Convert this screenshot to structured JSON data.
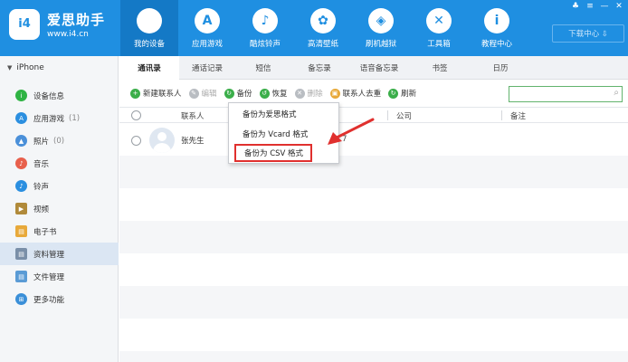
{
  "app": {
    "logo_text": "i4",
    "brand": "爱思助手",
    "site": "www.i4.cn",
    "download_label": "下载中心 ⇩",
    "window_controls": [
      "♣",
      "≡",
      "—",
      "✕"
    ]
  },
  "nav": [
    {
      "label": "我的设备",
      "icon": "apple-icon",
      "glyph": "",
      "active": true
    },
    {
      "label": "应用游戏",
      "icon": "app-store-icon",
      "glyph": "A"
    },
    {
      "label": "酷炫铃声",
      "icon": "bell-icon",
      "glyph": "♪"
    },
    {
      "label": "高清壁纸",
      "icon": "flower-icon",
      "glyph": "✿"
    },
    {
      "label": "刷机越狱",
      "icon": "dropbox-icon",
      "glyph": "◈"
    },
    {
      "label": "工具箱",
      "icon": "tools-icon",
      "glyph": "✕"
    },
    {
      "label": "教程中心",
      "icon": "info-icon",
      "glyph": "i"
    }
  ],
  "sidebar": {
    "device": "iPhone",
    "items": [
      {
        "label": "设备信息",
        "count": "",
        "icon": "info-circle-icon",
        "color": "#2fb344",
        "glyph": "i"
      },
      {
        "label": "应用游戏",
        "count": "(1)",
        "icon": "app-store-icon",
        "color": "#2b8fe0",
        "glyph": "A"
      },
      {
        "label": "照片",
        "count": "(0)",
        "icon": "photo-icon",
        "color": "#4a90d9",
        "glyph": "▲"
      },
      {
        "label": "音乐",
        "count": "",
        "icon": "music-icon",
        "color": "#e8604c",
        "glyph": "♪"
      },
      {
        "label": "铃声",
        "count": "",
        "icon": "bell-icon",
        "color": "#2b8fe0",
        "glyph": "♪"
      },
      {
        "label": "视频",
        "count": "",
        "icon": "video-icon",
        "color": "#b08a3a",
        "glyph": "▶"
      },
      {
        "label": "电子书",
        "count": "",
        "icon": "book-icon",
        "color": "#e8a93a",
        "glyph": "▤"
      },
      {
        "label": "资料管理",
        "count": "",
        "icon": "data-icon",
        "color": "#7a8fa8",
        "glyph": "▤",
        "active": true
      },
      {
        "label": "文件管理",
        "count": "",
        "icon": "folder-icon",
        "color": "#5a9bd5",
        "glyph": "▤"
      },
      {
        "label": "更多功能",
        "count": "",
        "icon": "grid-icon",
        "color": "#3a8fd8",
        "glyph": "⊞"
      }
    ]
  },
  "tabs": [
    {
      "label": "通讯录",
      "active": true
    },
    {
      "label": "通话记录"
    },
    {
      "label": "短信"
    },
    {
      "label": "备忘录"
    },
    {
      "label": "语音备忘录"
    },
    {
      "label": "书签"
    },
    {
      "label": "日历"
    }
  ],
  "toolbar": [
    {
      "label": "新建联系人",
      "icon": "add-icon",
      "color": "#3bae4a",
      "glyph": "+"
    },
    {
      "label": "编辑",
      "icon": "edit-icon",
      "color": "#b9bdc2",
      "glyph": "✎",
      "disabled": true
    },
    {
      "label": "备份",
      "icon": "backup-icon",
      "color": "#3bae4a",
      "glyph": "↻"
    },
    {
      "label": "恢复",
      "icon": "restore-icon",
      "color": "#3bae4a",
      "glyph": "↺"
    },
    {
      "label": "删除",
      "icon": "delete-icon",
      "color": "#b9bdc2",
      "glyph": "✕",
      "disabled": true
    },
    {
      "label": "联系人去重",
      "icon": "dedupe-icon",
      "color": "#e8a93a",
      "glyph": "▣"
    },
    {
      "label": "刷新",
      "icon": "refresh-icon",
      "color": "#3bae4a",
      "glyph": "↻"
    }
  ],
  "search": {
    "placeholder": ""
  },
  "table": {
    "columns": [
      "联系人",
      "公司",
      "备注"
    ],
    "rows": [
      {
        "name": "张先生",
        "phone_fragment": "7"
      }
    ]
  },
  "backup_menu": {
    "items": [
      "备份为爱思格式",
      "备份为 Vcard 格式",
      "备份为 CSV 格式"
    ],
    "highlight_color": "#e0302e"
  }
}
